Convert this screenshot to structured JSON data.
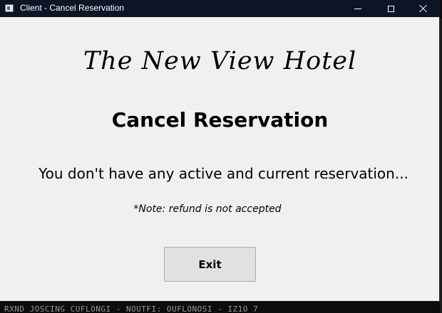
{
  "window": {
    "title": "Client - Cancel Reservation",
    "titlebar_color": "#0b1526",
    "background_color": "#f0f0f0"
  },
  "controls": {
    "minimize_icon": "minimize-icon",
    "maximize_icon": "maximize-icon",
    "close_icon": "close-icon"
  },
  "content": {
    "hotel_name": "The New View Hotel",
    "page_title": "Cancel Reservation",
    "message": "You don't have any active and current reservation...",
    "note": "*Note: refund is not accepted",
    "exit_label": "Exit"
  },
  "background_terminal": {
    "text": "RXND JOSCING CUFLONGI - NOUTFI: OUFLONOSI - IZ1O 7"
  }
}
